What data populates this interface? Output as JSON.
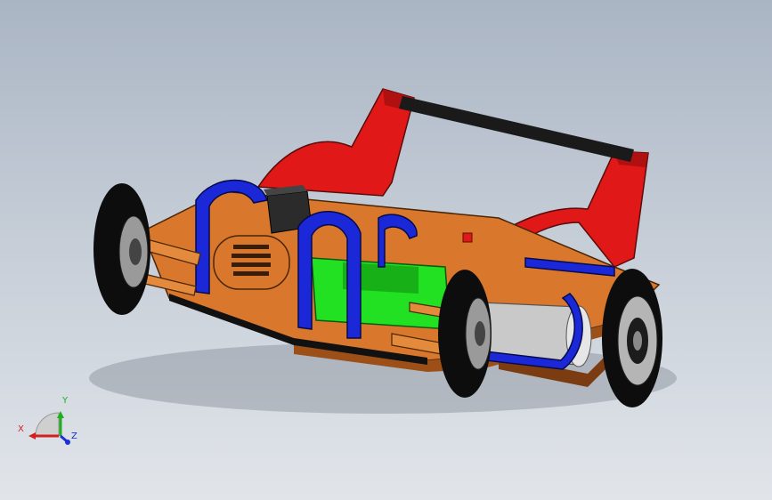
{
  "viewport": {
    "description_kind": "cad-3d-view",
    "background_top": "#aab5c4",
    "background_bottom": "#e1e5ea"
  },
  "colors": {
    "roll_cage": "#e01818",
    "chassis_plate": "#d9782c",
    "brackets": "#1a28d8",
    "battery": "#22e022",
    "motor": "#c9c9c9",
    "tire": "#0d0d0d",
    "rim": "#9a9a9a",
    "servo": "#2b2b2b"
  },
  "triad": {
    "x_label": "X",
    "y_label": "Y",
    "z_label": "Z",
    "x_color": "#d41f1f",
    "y_color": "#1fae1f",
    "z_color": "#1f2fd4"
  }
}
